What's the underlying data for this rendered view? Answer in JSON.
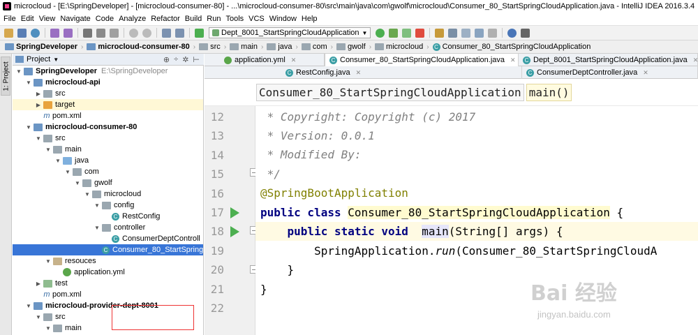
{
  "window": {
    "title": "microcloud - [E:\\SpringDeveloper] - [microcloud-consumer-80] - ...\\microcloud-consumer-80\\src\\main\\java\\com\\gwolf\\microcloud\\Consumer_80_StartSpringCloudApplication.java - IntelliJ IDEA 2016.3.4"
  },
  "menu": [
    "File",
    "Edit",
    "View",
    "Navigate",
    "Code",
    "Analyze",
    "Refactor",
    "Build",
    "Run",
    "Tools",
    "VCS",
    "Window",
    "Help"
  ],
  "toolbar": {
    "run_config": "Dept_8001_StartSpringCloudApplication",
    "icons": [
      "open-icon",
      "save-icon",
      "sync-icon",
      "undo-icon",
      "redo-icon",
      "cut-icon",
      "copy-icon",
      "paste-icon",
      "find-icon",
      "replace-icon",
      "back-icon",
      "forward-icon",
      "make-icon",
      "run-config-icon",
      "run-icon",
      "debug-icon",
      "coverage-icon",
      "stop-icon",
      "project-structure-icon",
      "settings-icon",
      "sdk-icon",
      "help-icon",
      "terminal-icon"
    ]
  },
  "breadcrumb": [
    "SpringDeveloper",
    "microcloud-consumer-80",
    "src",
    "main",
    "java",
    "com",
    "gwolf",
    "microcloud",
    "Consumer_80_StartSpringCloudApplication"
  ],
  "sidebar": {
    "vertical_tab": "1: Project"
  },
  "project_panel": {
    "title": "Project",
    "tree": [
      {
        "label": "SpringDeveloper",
        "note": "E:\\SpringDeveloper",
        "depth": 0,
        "icon": "module",
        "arrow": "down",
        "bold": true
      },
      {
        "label": "microcloud-api",
        "depth": 1,
        "icon": "module",
        "arrow": "down",
        "bold": true
      },
      {
        "label": "src",
        "depth": 2,
        "icon": "folder",
        "arrow": "right"
      },
      {
        "label": "target",
        "depth": 2,
        "icon": "target",
        "arrow": "right",
        "highlight": true
      },
      {
        "label": "pom.xml",
        "depth": 2,
        "icon": "pom",
        "arrow": ""
      },
      {
        "label": "microcloud-consumer-80",
        "depth": 1,
        "icon": "module",
        "arrow": "down",
        "bold": true
      },
      {
        "label": "src",
        "depth": 2,
        "icon": "folder",
        "arrow": "down"
      },
      {
        "label": "main",
        "depth": 3,
        "icon": "folder",
        "arrow": "down"
      },
      {
        "label": "java",
        "depth": 4,
        "icon": "src",
        "arrow": "down"
      },
      {
        "label": "com",
        "depth": 5,
        "icon": "folder",
        "arrow": "down"
      },
      {
        "label": "gwolf",
        "depth": 6,
        "icon": "folder",
        "arrow": "down"
      },
      {
        "label": "microcloud",
        "depth": 7,
        "icon": "folder",
        "arrow": "down"
      },
      {
        "label": "config",
        "depth": 8,
        "icon": "folder",
        "arrow": "down"
      },
      {
        "label": "RestConfig",
        "depth": 9,
        "icon": "cls",
        "arrow": ""
      },
      {
        "label": "controller",
        "depth": 8,
        "icon": "folder",
        "arrow": "down"
      },
      {
        "label": "ConsumerDeptControll",
        "depth": 9,
        "icon": "cls",
        "arrow": ""
      },
      {
        "label": "Consumer_80_StartSpringC",
        "depth": 8,
        "icon": "cls",
        "arrow": "",
        "selected": true
      },
      {
        "label": "resouces",
        "depth": 3,
        "icon": "res",
        "arrow": "down"
      },
      {
        "label": "application.yml",
        "depth": 4,
        "icon": "yml",
        "arrow": ""
      },
      {
        "label": "test",
        "depth": 2,
        "icon": "test",
        "arrow": "right"
      },
      {
        "label": "pom.xml",
        "depth": 2,
        "icon": "pom",
        "arrow": ""
      },
      {
        "label": "microcloud-provider-dept-8001",
        "depth": 1,
        "icon": "module",
        "arrow": "down",
        "bold": true
      },
      {
        "label": "src",
        "depth": 2,
        "icon": "folder",
        "arrow": "down"
      },
      {
        "label": "main",
        "depth": 3,
        "icon": "folder",
        "arrow": "down"
      }
    ]
  },
  "editor_tabs_row1": [
    {
      "label": "application.yml",
      "icon": "yml",
      "active": false
    },
    {
      "label": "Consumer_80_StartSpringCloudApplication.java",
      "icon": "cls",
      "active": true
    },
    {
      "label": "Dept_8001_StartSpringCloudApplication.java",
      "icon": "cls",
      "active": false
    }
  ],
  "editor_tabs_row2": [
    {
      "label": "RestConfig.java",
      "icon": "cls",
      "active": false
    },
    {
      "label": "ConsumerDeptController.java",
      "icon": "cls",
      "active": false
    }
  ],
  "editor_breadcrumb": {
    "class_name": "Consumer_80_StartSpringCloudApplication",
    "method_name": "main()"
  },
  "code": {
    "line_numbers": [
      "12",
      "13",
      "14",
      "15",
      "16",
      "17",
      "18",
      "19",
      "20",
      "21",
      "22"
    ],
    "l12": " * Copyright: Copyright (c) 2017",
    "l13": " * Version: 0.0.1",
    "l14": " * Modified By:",
    "l15": " */",
    "l16": "@SpringBootApplication",
    "l17_kw": "public class",
    "l17_cls": "Consumer_80_StartSpringCloudApplication",
    "l17_tail": " {",
    "l18_kw": "public static void",
    "l18_meth": "main",
    "l18_tail": "(String[] args) {",
    "l19_pre": "SpringApplication.",
    "l19_run": "run",
    "l19_tail": "(Consumer_80_StartSpringCloudA",
    "l20": "}",
    "l21": "}"
  },
  "watermark": {
    "text": "Bai  经验",
    "url": "jingyan.baidu.com"
  }
}
